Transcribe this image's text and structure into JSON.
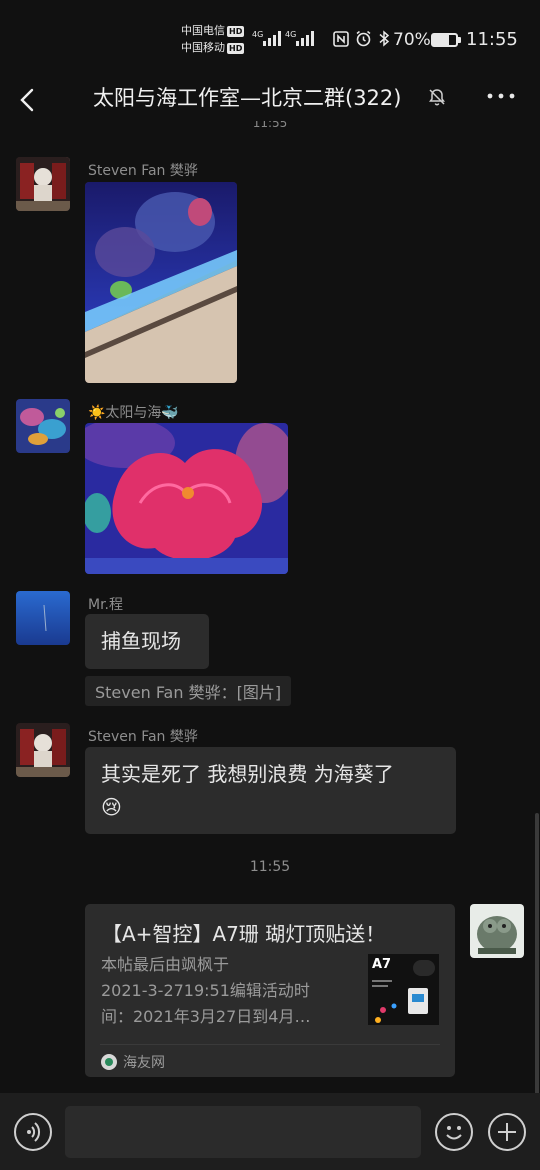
{
  "status_bar": {
    "carrier1": "中国电信",
    "carrier2": "中国移动",
    "hd_badge": "HD",
    "network1": "4G",
    "network2": "4G",
    "battery": "70%",
    "battery_level": 0.7,
    "time": "11:55"
  },
  "header": {
    "title": "太阳与海工作室—北京二群(322)",
    "back_icon": "chevron-left-icon",
    "mute_icon": "bell-off-icon",
    "more_icon": "more-dots-icon"
  },
  "messages": [
    {
      "sender": "Steven Fan 樊骅",
      "type": "image"
    },
    {
      "sender": "☀️太阳与海🐳",
      "type": "image"
    },
    {
      "sender": "Mr.程",
      "type": "text",
      "text": "捕鱼现场",
      "quote": "Steven Fan 樊骅：[图片]"
    },
    {
      "sender": "Steven Fan 樊骅",
      "type": "text",
      "text_line1": "其实是死了 我想别浪费 为海葵了",
      "text_line2": "😢"
    }
  ],
  "timestamp": "11:55",
  "link_card": {
    "title": "【A+智控】A7珊 瑚灯顶贴送！",
    "desc_line1": "本帖最后由飒枫于",
    "desc_line2": "2021-3-2719:51编辑活动时",
    "desc_line3": "间：2021年3月27日到4月…",
    "thumb_label": "A7",
    "source": "海友网"
  },
  "input_bar": {
    "voice_icon": "voice-icon",
    "emoji_icon": "emoji-icon",
    "add_icon": "plus-icon"
  }
}
